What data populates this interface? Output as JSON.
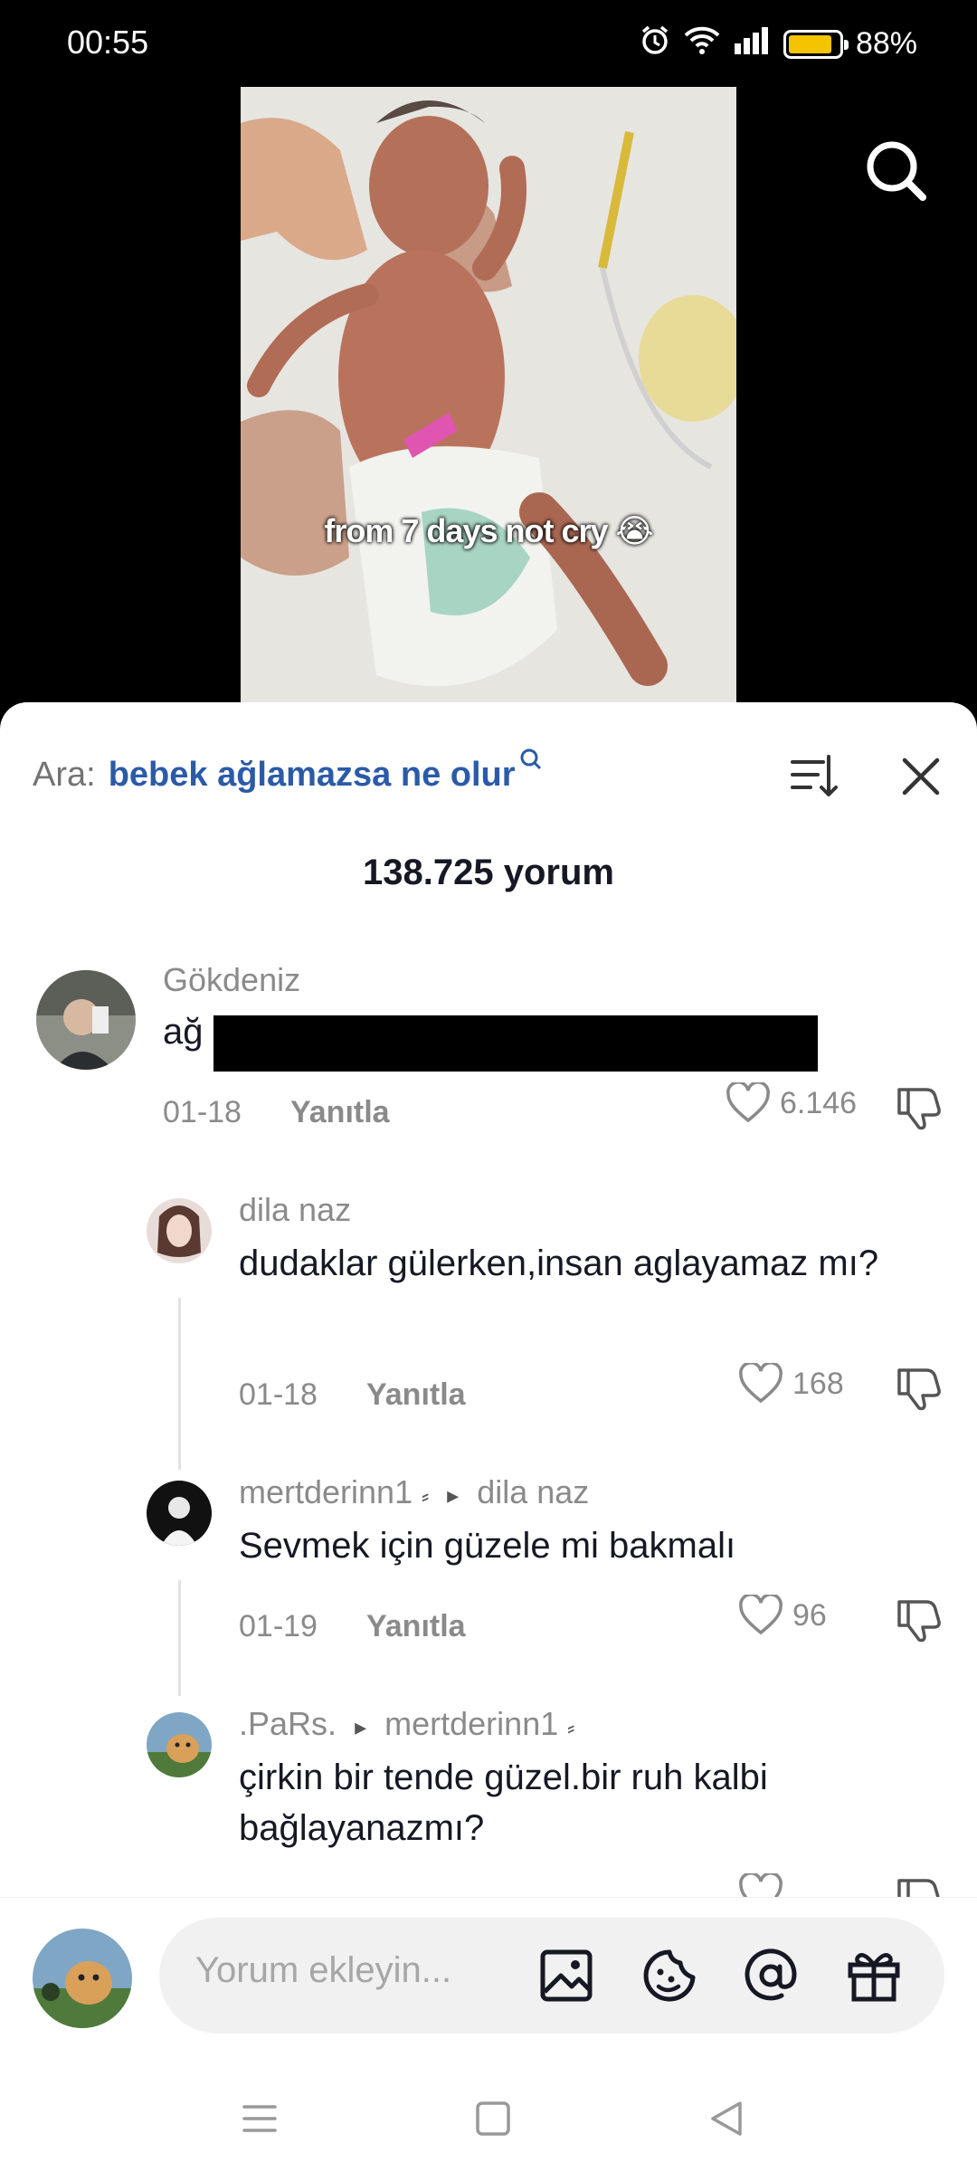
{
  "status_bar": {
    "time": "00:55",
    "battery_percent": "88%",
    "battery_level": 0.88,
    "icons": [
      "alarm-icon",
      "wifi-icon",
      "signal-icon",
      "battery-icon"
    ]
  },
  "video": {
    "caption": "from 7 days not cry 😭",
    "search_icon": "search-icon"
  },
  "comments_sheet": {
    "search_prefix": "Ara:",
    "search_query": "bebek ağlamazsa ne olur",
    "search_query_icon": "search-icon",
    "sort_icon": "sort-icon",
    "close_icon": "close-icon",
    "count_label": "138.725 yorum",
    "comments": [
      {
        "user": "Gökdeniz",
        "text": "ağ",
        "text_redacted": true,
        "date": "01-18",
        "reply_label": "Yanıtla",
        "likes": "6.146"
      },
      {
        "user": "dila naz",
        "text": "dudaklar gülerken,insan aglayamaz mı?",
        "date": "01-18",
        "reply_label": "Yanıtla",
        "likes": "168"
      },
      {
        "user": "mertderinn1",
        "reply_to": "dila naz",
        "text": "Sevmek için güzele mi bakmalı",
        "date": "01-19",
        "reply_label": "Yanıtla",
        "likes": "96"
      },
      {
        "user": ".PaRs.",
        "reply_to": "mertderinn1",
        "text": "çirkin bir tende güzel.bir ruh kalbi bağlayanazmı?"
      }
    ]
  },
  "input_bar": {
    "placeholder": "Yorum ekleyin...",
    "icons": [
      "image-icon",
      "emoji-icon",
      "mention-icon",
      "gift-icon"
    ]
  },
  "nav_bar": {
    "icons": [
      "menu-icon",
      "home-icon",
      "back-icon"
    ]
  },
  "colors": {
    "accent_link": "#2b5aa8",
    "battery": "#f4c400",
    "text_primary": "#161823",
    "text_secondary": "#8a8a8a"
  }
}
